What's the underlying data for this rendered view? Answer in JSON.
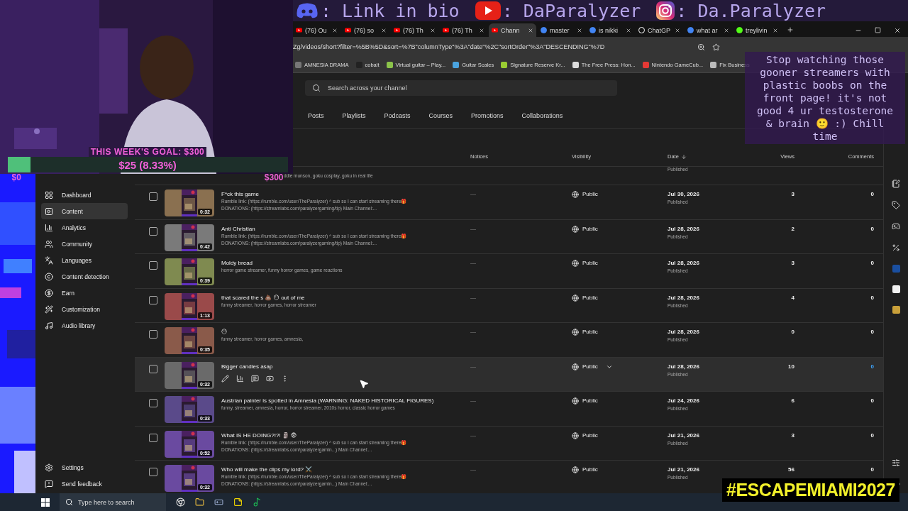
{
  "stream_banner": [
    {
      "kind": "discord",
      "text": ": Link in bio"
    },
    {
      "kind": "youtube",
      "text": ": DaParalyzer"
    },
    {
      "kind": "instagram",
      "text": ": Da.Paralyzer"
    }
  ],
  "browser": {
    "tabs": [
      {
        "kind": "youtube",
        "label": "(76) Ou",
        "selected": false
      },
      {
        "kind": "youtube",
        "label": "(76) so",
        "selected": false
      },
      {
        "kind": "youtube",
        "label": "(76) Th",
        "selected": false
      },
      {
        "kind": "youtube",
        "label": "(76) Th",
        "selected": false
      },
      {
        "kind": "studio",
        "label": "Chann",
        "selected": true
      },
      {
        "kind": "google",
        "label": "master",
        "selected": false
      },
      {
        "kind": "google",
        "label": "is nikki",
        "selected": false
      },
      {
        "kind": "chatgpt",
        "label": "ChatGP",
        "selected": false
      },
      {
        "kind": "google",
        "label": "what ar",
        "selected": false
      },
      {
        "kind": "kick",
        "label": "treylivin",
        "selected": false
      }
    ],
    "url": "Zg/videos/short?filter=%5B%5D&sort=%7B\"columnType\"%3A\"date\"%2C\"sortOrder\"%3A\"DESCENDING\"%7D",
    "bookmarks": [
      "AMNESIA DRAMA",
      "cobalt",
      "Virtual guitar – Play...",
      "Guitar Scales",
      "Signature Reserve Kr...",
      "The Free Press: Hon...",
      "Nintendo GameCub...",
      "Fix Business"
    ]
  },
  "studio": {
    "search": {
      "placeholder": "Search across your channel"
    },
    "sidebar": {
      "items": [
        {
          "label": "Dashboard",
          "selected": false
        },
        {
          "label": "Content",
          "selected": true
        },
        {
          "label": "Analytics",
          "selected": false
        },
        {
          "label": "Community",
          "selected": false
        },
        {
          "label": "Languages",
          "selected": false
        },
        {
          "label": "Content detection",
          "selected": false
        },
        {
          "label": "Earn",
          "selected": false
        },
        {
          "label": "Customization",
          "selected": false
        },
        {
          "label": "Audio library",
          "selected": false
        }
      ],
      "footer": [
        "Settings",
        "Send feedback"
      ]
    },
    "channel_tabs": [
      {
        "label": "Posts",
        "selected": false
      },
      {
        "label": "Playlists",
        "selected": false
      },
      {
        "label": "Podcasts",
        "selected": false
      },
      {
        "label": "Courses",
        "selected": false
      },
      {
        "label": "Promotions",
        "selected": false
      },
      {
        "label": "Collaborations",
        "selected": false
      }
    ],
    "table": {
      "columns": [
        "Notices",
        "Visibility",
        "Date",
        "Views",
        "Comments"
      ],
      "partial_row": {
        "description": "ddie munson, goku cosplay, goku in real life",
        "status": "Published"
      },
      "rows": [
        {
          "title": "F*ck this game",
          "duration": "0:32",
          "description": [
            "Rumble link: (https://rumble.com/user/TheParalyzer) ^ sub so I can start streaming there🎁",
            "DONATIONS: (https://streamlabs.com/paralyzergaming/tip) Main Channel:..."
          ],
          "notice": "—",
          "visibility": "Public",
          "date": "Jul 30, 2026",
          "status": "Published",
          "views": "3",
          "comments": "0",
          "checked": false,
          "hovered": false
        },
        {
          "title": "Anti Christian",
          "duration": "0:42",
          "description": [
            "Rumble link: (https://rumble.com/user/TheParalyzer) ^ sub so I can start streaming there🎁",
            "DONATIONS: (https://streamlabs.com/paralyzergaming/tip) Main Channel:..."
          ],
          "notice": "—",
          "visibility": "Public",
          "date": "Jul 28, 2026",
          "status": "Published",
          "views": "2",
          "comments": "0",
          "checked": false,
          "hovered": false
        },
        {
          "title": "Moldy bread",
          "duration": "0:39",
          "description": [
            "horror game streamer, funny horror games, game reactions"
          ],
          "notice": "—",
          "visibility": "Public",
          "date": "Jul 28, 2026",
          "status": "Published",
          "views": "3",
          "comments": "0",
          "checked": false,
          "hovered": false
        },
        {
          "title": "that scared the s 💩 😶 out of me",
          "duration": "1:13",
          "description": [
            "funny streamer, horror games, horror streamer"
          ],
          "notice": "—",
          "visibility": "Public",
          "date": "Jul 28, 2026",
          "status": "Published",
          "views": "4",
          "comments": "0",
          "checked": false,
          "hovered": false
        },
        {
          "title": "😶",
          "duration": "0:35",
          "description": [
            "funny streamer, horror games, amnesia,"
          ],
          "notice": "—",
          "visibility": "Public",
          "date": "Jul 28, 2026",
          "status": "Published",
          "views": "0",
          "comments": "0",
          "checked": false,
          "hovered": false
        },
        {
          "title": "Bigger candles asap",
          "duration": "0:32",
          "notice": "—",
          "visibility": "Public",
          "date": "Jul 28, 2026",
          "status": "Published",
          "views": "10",
          "comments": "0",
          "checked": false,
          "hovered": true
        },
        {
          "title": "Austrian painter is spotted in Amnesia (WARNING: NAKED HISTORICAL FIGURES)",
          "duration": "0:33",
          "description": [
            "funny, streamer, amnesia, horror, horror streamer, 2010s horror, classic horror games"
          ],
          "notice": "—",
          "visibility": "Public",
          "date": "Jul 24, 2026",
          "status": "Published",
          "views": "6",
          "comments": "0",
          "checked": false,
          "hovered": false
        },
        {
          "title": "What IS HE DOING?!?! 🗿 😨",
          "duration": "0:52",
          "description": [
            "Rumble link: (https://rumble.com/user/TheParalyzer) ^ sub so I can start streaming there🎁",
            "DONATIONS: (https://streamlabs.com/paralyzergamin...) Main Channel:..."
          ],
          "notice": "—",
          "visibility": "Public",
          "date": "Jul 21, 2026",
          "status": "Published",
          "views": "3",
          "comments": "0",
          "checked": false,
          "hovered": false
        },
        {
          "title": "Who will make the clips my lord? ⚔️",
          "duration": "0:32",
          "description": [
            "Rumble link: (https://rumble.com/user/TheParalyzer) ^ sub so I can start streaming there🎁",
            "DONATIONS: (https://streamlabs.com/paralyzergamin...) Main Channel:..."
          ],
          "notice": "—",
          "visibility": "Public",
          "date": "Jul 21, 2026",
          "status": "Published",
          "views": "56",
          "comments": "0",
          "checked": false,
          "hovered": false
        }
      ]
    }
  },
  "goal": {
    "title": "THIS WEEK'S GOAL: $300",
    "progress": "$25 (8.33%)",
    "level": 0.0833,
    "min": "$0",
    "max": "$300"
  },
  "chat_message": "Stop watching those gooner streamers with plastic boobs on the front page! it's not good 4 ur testosterone & brain 🙂 :) Chill time",
  "hashtag": "#ESCAPEMIAMI2027",
  "taskbar": {
    "search": {
      "placeholder": "Type here to search"
    }
  }
}
